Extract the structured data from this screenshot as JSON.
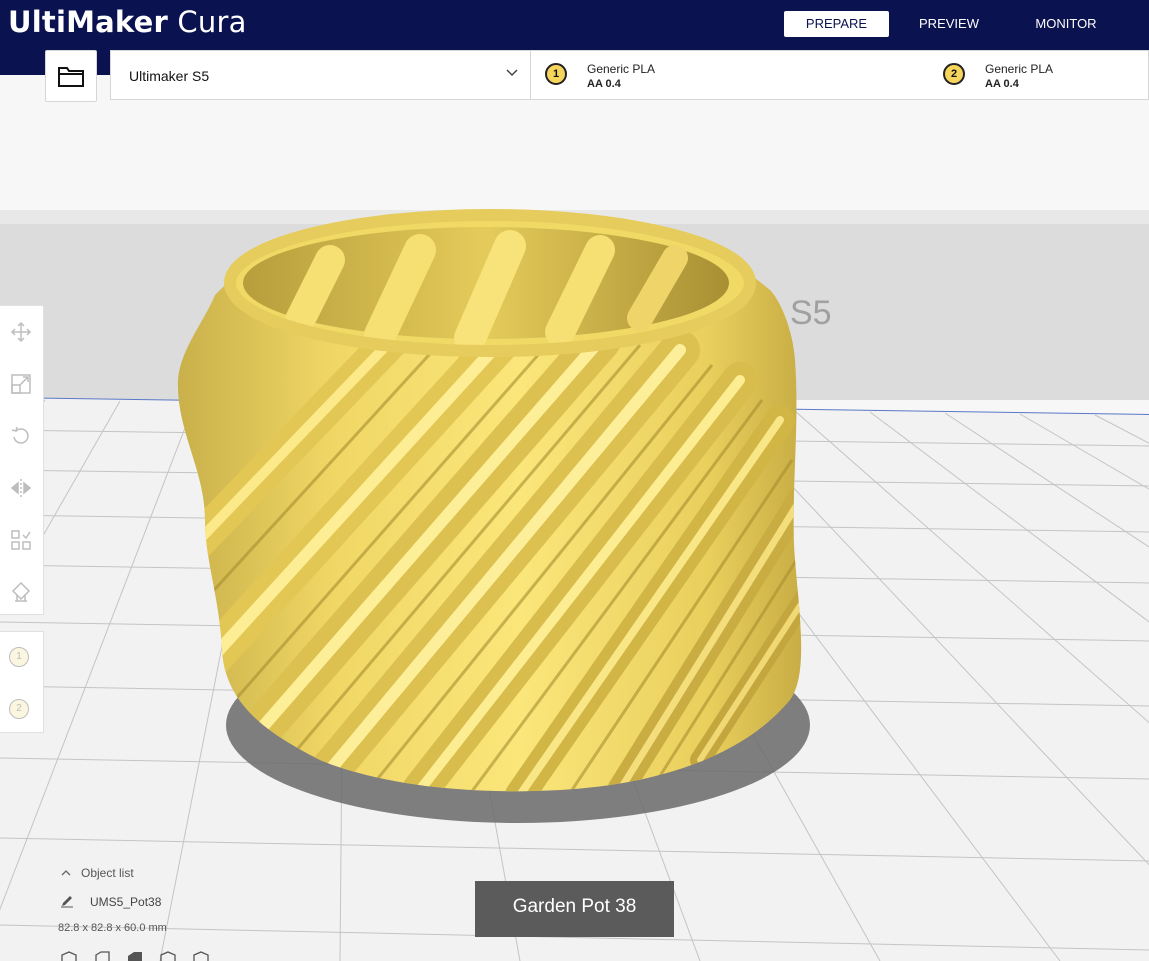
{
  "app": {
    "brand": "UltiMaker",
    "product": " Cura"
  },
  "stages": [
    {
      "label": "PREPARE",
      "active": true
    },
    {
      "label": "PREVIEW",
      "active": false
    },
    {
      "label": "MONITOR",
      "active": false
    }
  ],
  "printer": {
    "name": "Ultimaker S5"
  },
  "extruders": [
    {
      "number": "1",
      "material": "Generic PLA",
      "core": "AA 0.4"
    },
    {
      "number": "2",
      "material": "Generic PLA",
      "core": "AA 0.4"
    }
  ],
  "buildplate_label": "S5",
  "object_list": {
    "toggle_label": "Object list",
    "object_name": "UMS5_Pot38",
    "dimensions": "82.8 x 82.8 x 60.0 mm"
  },
  "toast": {
    "message": "Garden Pot 38"
  },
  "colors": {
    "header": "#0b1250",
    "model": "#f3dc6c",
    "accent": "#f6d55c"
  },
  "tools": [
    "move-icon",
    "scale-icon",
    "rotate-icon",
    "mirror-icon",
    "per-model-settings-icon",
    "support-blocker-icon"
  ]
}
